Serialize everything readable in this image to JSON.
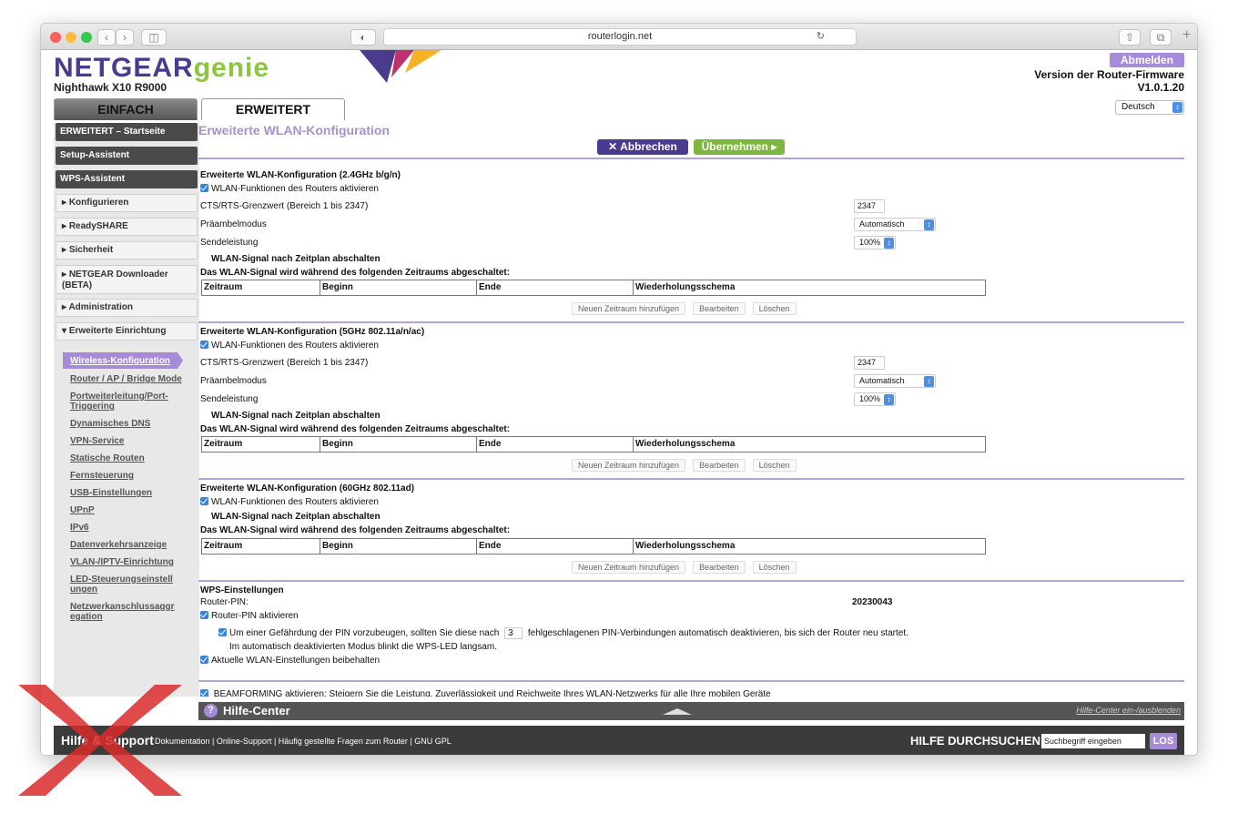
{
  "browser": {
    "url": "routerlogin.net"
  },
  "header": {
    "logo_main": "NETGEAR",
    "logo_genie": "genie",
    "model": "Nighthawk X10 R9000",
    "logout": "Abmelden",
    "fw_label": "Version der Router-Firmware",
    "fw_version": "V1.0.1.20",
    "language": "Deutsch"
  },
  "tabs": [
    "EINFACH",
    "ERWEITERT"
  ],
  "sidebar": {
    "dark": [
      "ERWEITERT – Startseite",
      "Setup-Assistent",
      "WPS-Assistent"
    ],
    "sections": [
      "Konfigurieren",
      "ReadySHARE",
      "Sicherheit",
      "NETGEAR Downloader (BETA)",
      "Administration",
      "Erweiterte Einrichtung"
    ],
    "sublinks": [
      "Wireless-Konfiguration",
      "Router / AP / Bridge Mode",
      "Portweiterleitung/Port-Triggering",
      "Dynamisches DNS",
      "VPN-Service",
      "Statische Routen",
      "Fernsteuerung",
      "USB-Einstellungen",
      "UPnP",
      "IPv6",
      "Datenverkehrsanzeige",
      "VLAN-/IPTV-Einrichtung",
      "LED-Steuerungseinstellungen",
      "Netzwerkanschlussaggregation"
    ]
  },
  "main": {
    "title": "Erweiterte WLAN-Konfiguration",
    "cancel": "Abbrechen",
    "apply": "Übernehmen",
    "sec24": "Erweiterte WLAN-Konfiguration (2.4GHz b/g/n)",
    "sec5": "Erweiterte WLAN-Konfiguration (5GHz 802.11a/n/ac)",
    "sec60": "Erweiterte WLAN-Konfiguration (60GHz 802.11ad)",
    "enable_wlan": "WLAN-Funktionen des Routers aktivieren",
    "cts_label": "CTS/RTS-Grenzwert (Bereich 1 bis 2347)",
    "cts_value": "2347",
    "preamble_label": "Präambelmodus",
    "preamble_value": "Automatisch",
    "power_label": "Sendeleistung",
    "power_value": "100%",
    "schedule_off": "WLAN-Signal nach Zeitplan abschalten",
    "schedule_info": "Das WLAN-Signal wird während des folgenden Zeitraums abgeschaltet:",
    "table_headers": [
      "Zeitraum",
      "Beginn",
      "Ende",
      "Wiederholungsschema"
    ],
    "add_period": "Neuen Zeitraum hinzufügen",
    "edit": "Bearbeiten",
    "delete": "Löschen",
    "wps_title": "WPS-Einstellungen",
    "router_pin_label": "Router-PIN:",
    "router_pin": "20230043",
    "router_pin_enable": "Router-PIN aktivieren",
    "pin_protect_a": "Um einer Gefährdung der PIN vorzubeugen, sollten Sie diese nach",
    "pin_attempts": "3",
    "pin_protect_b": "fehlgeschlagenen PIN-Verbindungen automatisch deaktivieren, bis sich der Router neu startet.",
    "pin_protect_c": "Im automatisch deaktivierten Modus blinkt die WPS-LED langsam.",
    "keep_settings": "Aktuelle WLAN-Einstellungen beibehalten",
    "beamforming": "BEAMFORMING aktivieren: Steigern Sie die Leistung, Zuverlässigkeit und Reichweite Ihres WLAN-Netzwerks für alle Ihre mobilen Geräte"
  },
  "help_center": {
    "title": "Hilfe-Center",
    "toggle": "Hilfe-Center ein-/ausblenden"
  },
  "footer": {
    "support": "Hilfe & Support",
    "links": [
      "Dokumentation",
      "Online-Support",
      "Häufig gestellte Fragen zum Router",
      "GNU GPL"
    ],
    "search_label": "HILFE DURCHSUCHEN",
    "search_placeholder": "Suchbegriff eingeben",
    "search_btn": "LOS"
  }
}
